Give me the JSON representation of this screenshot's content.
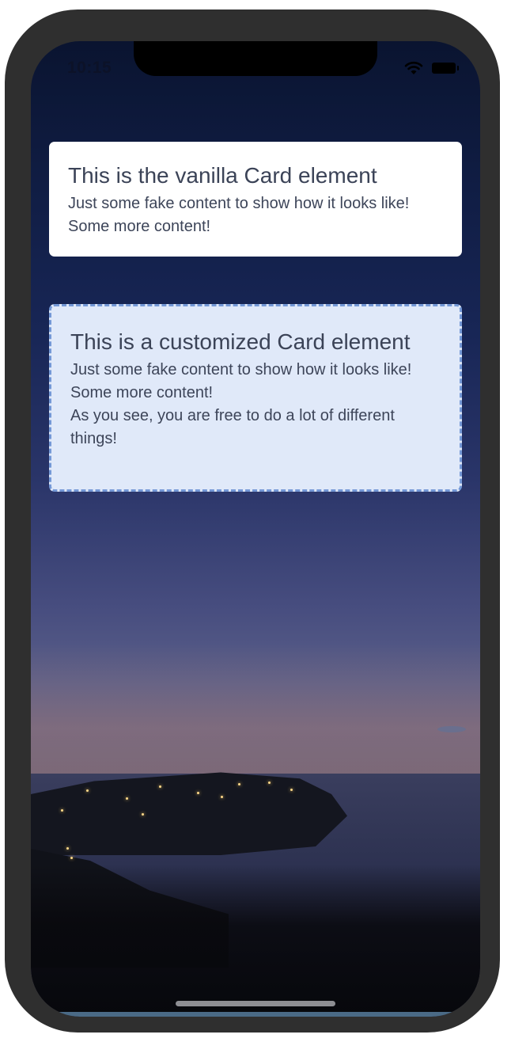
{
  "status_bar": {
    "time": "10:15",
    "icons": [
      "wifi-icon",
      "battery-icon"
    ]
  },
  "vanilla_card": {
    "title": "This is the vanilla Card element",
    "lines": [
      "Just some fake content to show how it looks like!",
      "Some more content!"
    ]
  },
  "custom_card": {
    "title": "This is a customized Card element",
    "lines": [
      "Just some fake content to show how it looks like!",
      "Some more content!",
      "As you see, you are free to do a lot of different things!"
    ]
  },
  "colors": {
    "card_background": "#ffffff",
    "custom_card_background": "#e0e9f9",
    "custom_card_border": "#7498d6",
    "text": "#3b4357",
    "device_frame": "#2f2f2f"
  }
}
